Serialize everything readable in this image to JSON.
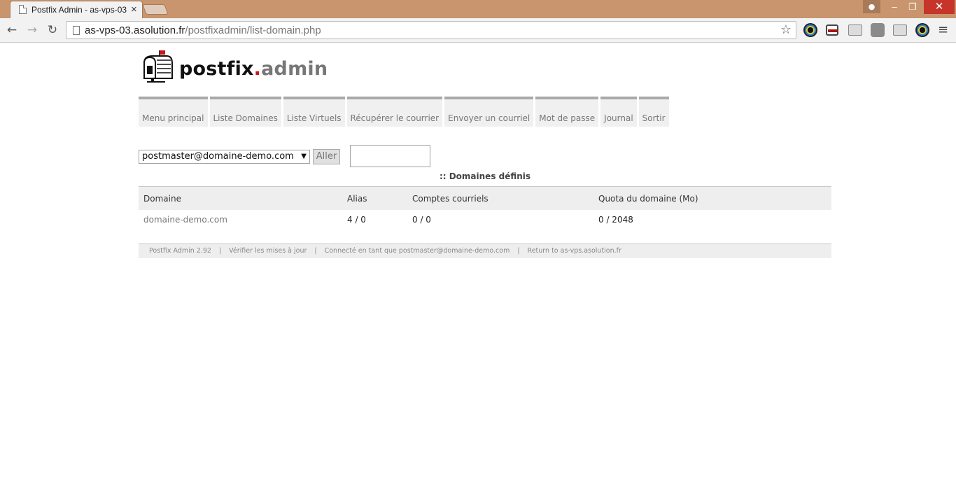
{
  "browser": {
    "tab_title": "Postfix Admin - as-vps-03",
    "url_host": "as-vps-03.asolution.fr",
    "url_path": "/postfixadmin/list-domain.php"
  },
  "logo": {
    "part1": "postfix",
    "dot": ".",
    "part2": "admin"
  },
  "menu": {
    "items": [
      {
        "label": "Menu principal"
      },
      {
        "label": "Liste Domaines"
      },
      {
        "label": "Liste Virtuels"
      },
      {
        "label": "Récupérer le courrier"
      },
      {
        "label": "Envoyer un courriel"
      },
      {
        "label": "Mot de passe"
      },
      {
        "label": "Journal"
      },
      {
        "label": "Sortir"
      }
    ]
  },
  "filter": {
    "selected_admin": "postmaster@domaine-demo.com",
    "go_label": "Aller",
    "search_value": ""
  },
  "list": {
    "title": ":: Domaines définis",
    "columns": [
      "Domaine",
      "Alias",
      "Comptes courriels",
      "Quota du domaine (Mo)"
    ],
    "rows": [
      {
        "domain": "domaine-demo.com",
        "aliases": "4 / 0",
        "mailboxes": "0 / 0",
        "quota": "0 / 2048"
      }
    ]
  },
  "footer": {
    "version": "Postfix Admin 2.92",
    "check_updates": "Vérifier les mises à jour",
    "logged_in_as": "Connecté en tant que postmaster@domaine-demo.com",
    "return_link": "Return to as-vps.asolution.fr"
  },
  "colors": {
    "titlebar": "#c8956e",
    "logo_dot": "#d0121a",
    "menu_tab_top": "#a9a9a9"
  }
}
